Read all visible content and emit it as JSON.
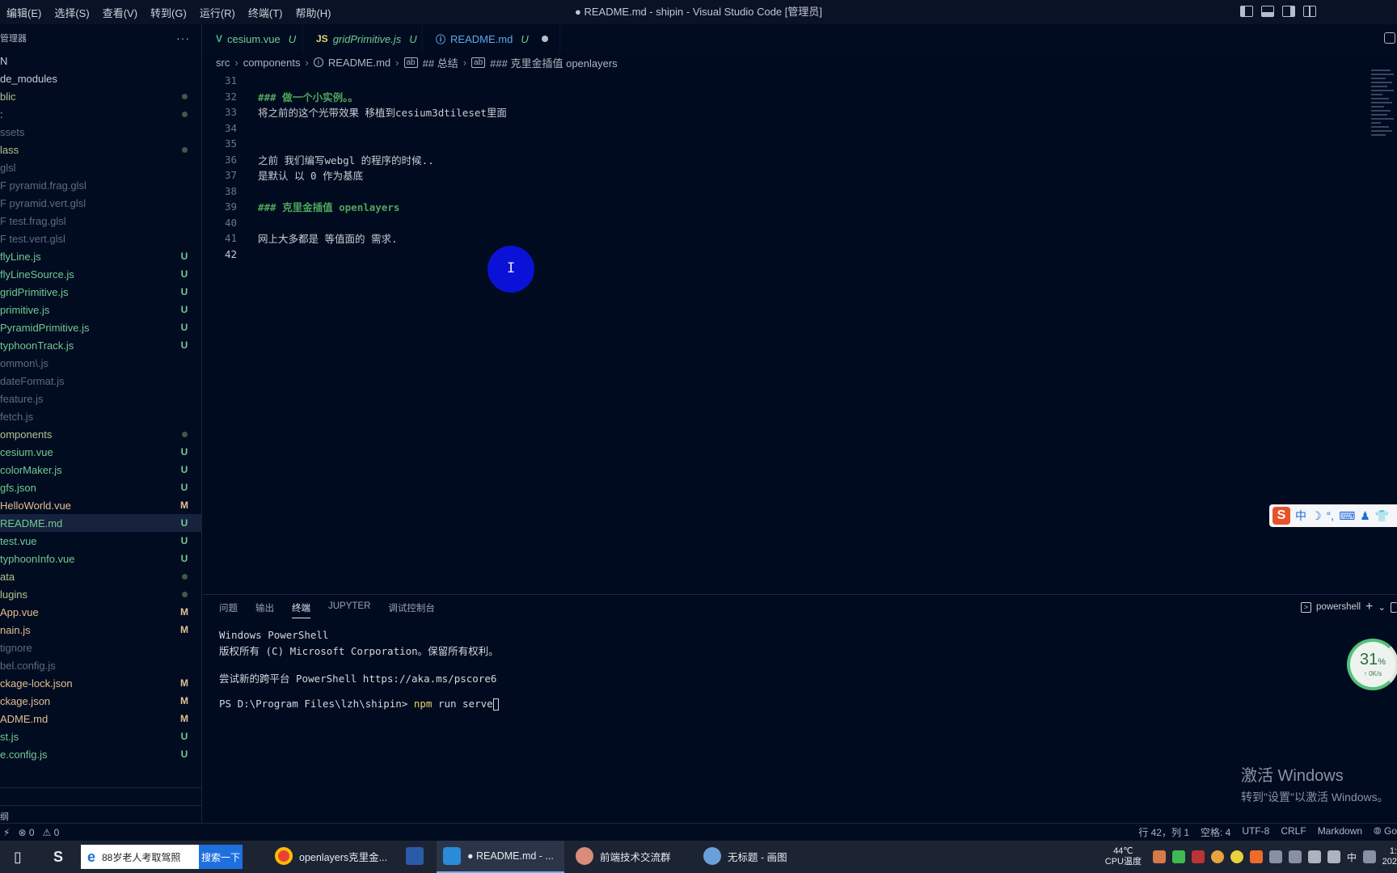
{
  "titlebar": {
    "menu": [
      "编辑(E)",
      "选择(S)",
      "查看(V)",
      "转到(G)",
      "运行(R)",
      "终端(T)",
      "帮助(H)"
    ],
    "title": "● README.md - shipin - Visual Studio Code [管理员]"
  },
  "sidebar": {
    "header": "管理器",
    "more": "···",
    "items": [
      {
        "label": "N",
        "color": "white",
        "status": ""
      },
      {
        "label": "de_modules",
        "color": "white",
        "status": ""
      },
      {
        "label": "blic",
        "color": "olive",
        "status": "dot"
      },
      {
        "label": ":",
        "color": "olive",
        "status": "dot"
      },
      {
        "label": "ssets",
        "color": "dim",
        "status": ""
      },
      {
        "label": "lass",
        "color": "olive",
        "status": "dot"
      },
      {
        "label": "glsl",
        "color": "dim",
        "status": ""
      },
      {
        "label": "F pyramid.frag.glsl",
        "color": "dim",
        "status": ""
      },
      {
        "label": "F pyramid.vert.glsl",
        "color": "dim",
        "status": ""
      },
      {
        "label": "F test.frag.glsl",
        "color": "dim",
        "status": ""
      },
      {
        "label": "F test.vert.glsl",
        "color": "dim",
        "status": ""
      },
      {
        "label": "flyLine.js",
        "color": "green",
        "status": "U"
      },
      {
        "label": "flyLineSource.js",
        "color": "green",
        "status": "U"
      },
      {
        "label": "gridPrimitive.js",
        "color": "green",
        "status": "U"
      },
      {
        "label": "primitive.js",
        "color": "green",
        "status": "U"
      },
      {
        "label": "PyramidPrimitive.js",
        "color": "green",
        "status": "U"
      },
      {
        "label": "typhoonTrack.js",
        "color": "green",
        "status": "U"
      },
      {
        "label": "ommon\\.js",
        "color": "dim",
        "status": ""
      },
      {
        "label": "dateFormat.js",
        "color": "dim",
        "status": ""
      },
      {
        "label": "feature.js",
        "color": "dim",
        "status": ""
      },
      {
        "label": "fetch.js",
        "color": "dim",
        "status": ""
      },
      {
        "label": "omponents",
        "color": "olive",
        "status": "dot"
      },
      {
        "label": "cesium.vue",
        "color": "green",
        "status": "U"
      },
      {
        "label": "colorMaker.js",
        "color": "green",
        "status": "U"
      },
      {
        "label": "gfs.json",
        "color": "green",
        "status": "U"
      },
      {
        "label": "HelloWorld.vue",
        "color": "yellow",
        "status": "M"
      },
      {
        "label": "README.md",
        "color": "green",
        "status": "U",
        "selected": true
      },
      {
        "label": "test.vue",
        "color": "green",
        "status": "U"
      },
      {
        "label": "typhoonInfo.vue",
        "color": "green",
        "status": "U"
      },
      {
        "label": "ata",
        "color": "olive",
        "status": "dot"
      },
      {
        "label": "lugins",
        "color": "olive",
        "status": "dot"
      },
      {
        "label": "App.vue",
        "color": "yellow",
        "status": "M"
      },
      {
        "label": "nain.js",
        "color": "yellow",
        "status": "M"
      },
      {
        "label": "tignore",
        "color": "dim",
        "status": ""
      },
      {
        "label": "bel.config.js",
        "color": "dim",
        "status": ""
      },
      {
        "label": "ckage-lock.json",
        "color": "yellow",
        "status": "M"
      },
      {
        "label": "ckage.json",
        "color": "yellow",
        "status": "M"
      },
      {
        "label": "ADME.md",
        "color": "yellow",
        "status": "M"
      },
      {
        "label": "st.js",
        "color": "green",
        "status": "U"
      },
      {
        "label": "e.config.js",
        "color": "green",
        "status": "U"
      }
    ],
    "footer": "纲"
  },
  "tabs": [
    {
      "icon": "V",
      "icon_color": "#41b883",
      "label": "cesium.vue",
      "status": "U",
      "italic": false
    },
    {
      "icon": "JS",
      "icon_color": "#e5d36b",
      "label": "gridPrimitive.js",
      "status": "U",
      "italic": true
    },
    {
      "icon": "ⓘ",
      "icon_color": "#5fa6e8",
      "label": "README.md",
      "status": "U",
      "active": true,
      "dirty": true
    }
  ],
  "breadcrumb": [
    "src",
    "components",
    "README.md",
    "## 总结",
    "### 克里金插值 openlayers"
  ],
  "editor": {
    "lines": [
      {
        "n": "31",
        "text": "",
        "style": ""
      },
      {
        "n": "32",
        "text": "### 做一个小实例。。",
        "style": "heading"
      },
      {
        "n": "33",
        "text": "将之前的这个光带效果 移植到cesium3dtileset里面",
        "style": ""
      },
      {
        "n": "34",
        "text": "",
        "style": ""
      },
      {
        "n": "35",
        "text": "",
        "style": ""
      },
      {
        "n": "36",
        "text": "之前 我们编写webgl 的程序的时候..",
        "style": ""
      },
      {
        "n": "37",
        "text": "是默认 以 0 作为基底",
        "style": ""
      },
      {
        "n": "38",
        "text": "",
        "style": ""
      },
      {
        "n": "39",
        "text": "### 克里金插值 openlayers",
        "style": "heading"
      },
      {
        "n": "40",
        "text": "",
        "style": ""
      },
      {
        "n": "41",
        "text": "网上大多都是 等值面的 需求.",
        "style": ""
      },
      {
        "n": "42",
        "text": "",
        "style": "current"
      }
    ]
  },
  "ime": {
    "logo": "S",
    "items": [
      "中",
      "☽",
      "°,",
      "⌨",
      "♟",
      "👕"
    ]
  },
  "panel": {
    "tabs": [
      "问题",
      "输出",
      "终端",
      "JUPYTER",
      "调试控制台"
    ],
    "active_tab": "终端",
    "shell": "powershell",
    "add": "+",
    "chevron": "⌄",
    "terminal": {
      "line1": "Windows PowerShell",
      "line2": "版权所有 (C) Microsoft Corporation。保留所有权利。",
      "line3": "尝试新的跨平台 PowerShell https://aka.ms/pscore6",
      "prompt": "PS D:\\Program Files\\lzh\\shipin> ",
      "cmd": "npm",
      "args": " run serve"
    }
  },
  "speed": {
    "percent": "31",
    "pct_sign": "%",
    "rate": "↑ 0K/s"
  },
  "watermark": {
    "line1": "激活 Windows",
    "line2": "转到\"设置\"以激活 Windows。"
  },
  "statusbar": {
    "left_icon": "⚡",
    "errors": "⊗ 0",
    "warnings": "⚠ 0",
    "position": "行 42，列 1",
    "spaces": "空格: 4",
    "encoding": "UTF-8",
    "eol": "CRLF",
    "language": "Markdown",
    "go": "⦾ Go"
  },
  "taskbar": {
    "search_text": "88岁老人考取驾照",
    "search_button": "搜索一下",
    "apps": [
      {
        "label": "openlayers克里金...",
        "icon_color": "#e94235"
      },
      {
        "label": "PowerShell",
        "icon_color": "#2a5ba8",
        "hide_label": true
      },
      {
        "label": "● README.md - ...",
        "icon_color": "#2b8bd9",
        "active": true
      },
      {
        "label": "前端技术交流群",
        "icon_color": "#d98c7a"
      },
      {
        "label": "无标题 - 画图",
        "icon_color": "#6aa0d8"
      }
    ],
    "temp": "44℃",
    "temp_label": "CPU温度",
    "ime_lang": "中",
    "clock_time": "1:",
    "clock_date": "202"
  }
}
